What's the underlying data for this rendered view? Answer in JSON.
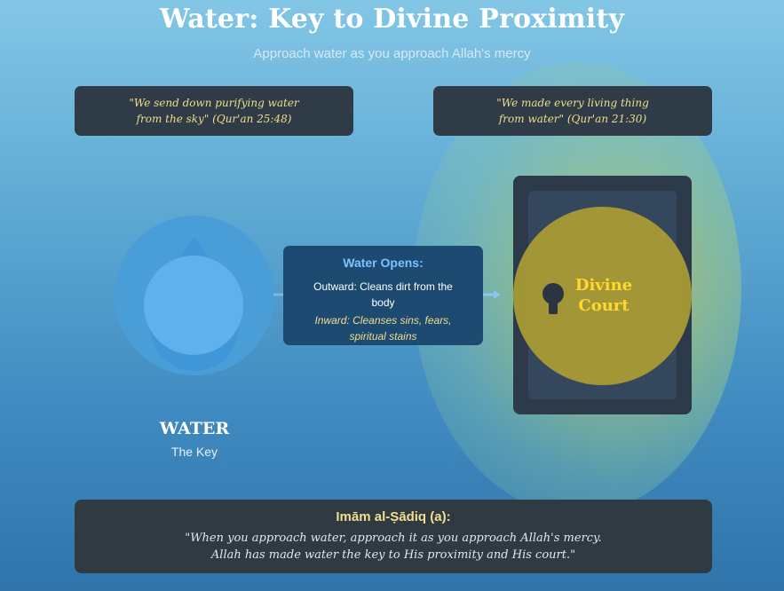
{
  "header": {
    "title": "Water: Key to Divine Proximity",
    "subtitle": "Approach water as you approach Allah's mercy"
  },
  "quotes": [
    {
      "lines": [
        "\"We send down purifying water",
        "from the sky\" (Qur'an 25:48)"
      ]
    },
    {
      "lines": [
        "\"We made every living thing",
        "from water\" (Qur'an 21:30)"
      ]
    }
  ],
  "water": {
    "label": "WATER",
    "sublabel": "The Key",
    "icon": "water-drop-icon"
  },
  "opens": {
    "title": "Water Opens:",
    "outward": "Outward: Cleans dirt from the body",
    "inward": "Inward: Cleanses sins, fears, spiritual stains"
  },
  "court": {
    "lines": [
      "Divine",
      "Court"
    ],
    "icon": "keyhole-icon"
  },
  "hadith": {
    "title": "Imām al-Ṣādiq (a):",
    "lines": [
      "\"When you approach water, approach it as you approach Allah's mercy.",
      "Allah has made water the key to His proximity and His court.\""
    ]
  },
  "colors": {
    "water": "#4a9ed8",
    "water_light": "#5fb0ec",
    "court_gold": "#b2a232",
    "court_text": "#ffd92a",
    "quote_text": "#f0dc8a",
    "panel_dark": "#2f3c48",
    "opens_box": "#1d4a70"
  }
}
